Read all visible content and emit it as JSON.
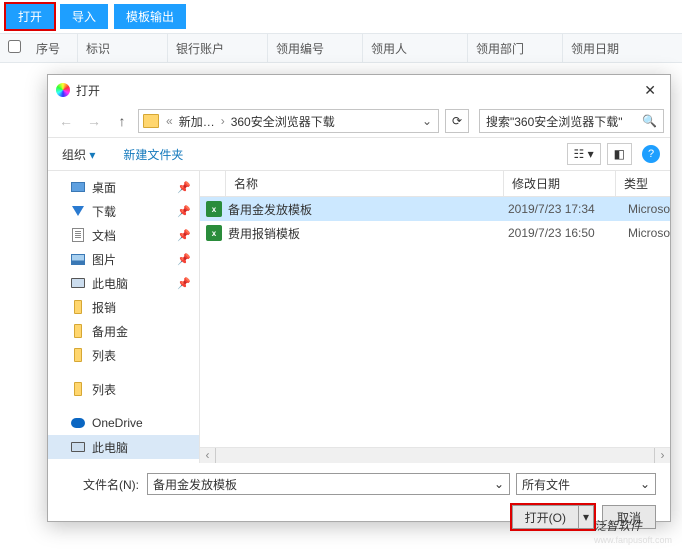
{
  "topbar": {
    "open": "打开",
    "import": "导入",
    "tpl": "模板输出"
  },
  "grid": {
    "seq": "序号",
    "mark": "标识",
    "bank": "银行账户",
    "recvNo": "领用编号",
    "recvPerson": "领用人",
    "recvDept": "领用部门",
    "recvDate": "领用日期"
  },
  "dialog": {
    "title": "打开",
    "crumbs": {
      "a": "新加…",
      "b": "360安全浏览器下载"
    },
    "searchPlaceholder": "搜索\"360安全浏览器下载\"",
    "organize": "组织",
    "newFolder": "新建文件夹",
    "tree": [
      {
        "label": "桌面",
        "icon": "sq"
      },
      {
        "label": "下载",
        "icon": "dl"
      },
      {
        "label": "文档",
        "icon": "doc"
      },
      {
        "label": "图片",
        "icon": "img"
      },
      {
        "label": "此电脑",
        "icon": "pc"
      },
      {
        "label": "报销",
        "icon": "fld"
      },
      {
        "label": "备用金",
        "icon": "fld"
      },
      {
        "label": "列表",
        "icon": "fld"
      },
      {
        "label": "列表",
        "icon": "fld"
      },
      {
        "label": "OneDrive",
        "icon": "cloud"
      },
      {
        "label": "此电脑",
        "icon": "pc",
        "sel": true
      }
    ],
    "fileHead": {
      "name": "名称",
      "date": "修改日期",
      "type": "类型",
      "nameBlank": ""
    },
    "files": [
      {
        "name": "备用金发放模板",
        "date": "2019/7/23 17:34",
        "type": "Microso",
        "sel": true
      },
      {
        "name": "费用报销模板",
        "date": "2019/7/23 16:50",
        "type": "Microso"
      }
    ],
    "fnLabel": "文件名(N):",
    "fnValue": "备用金发放模板",
    "filter": "所有文件",
    "openBtn": "打开(O)",
    "cancel": "取消"
  },
  "watermark": {
    "big": "泛智软件",
    "small": "www.fanpusoft.com"
  }
}
